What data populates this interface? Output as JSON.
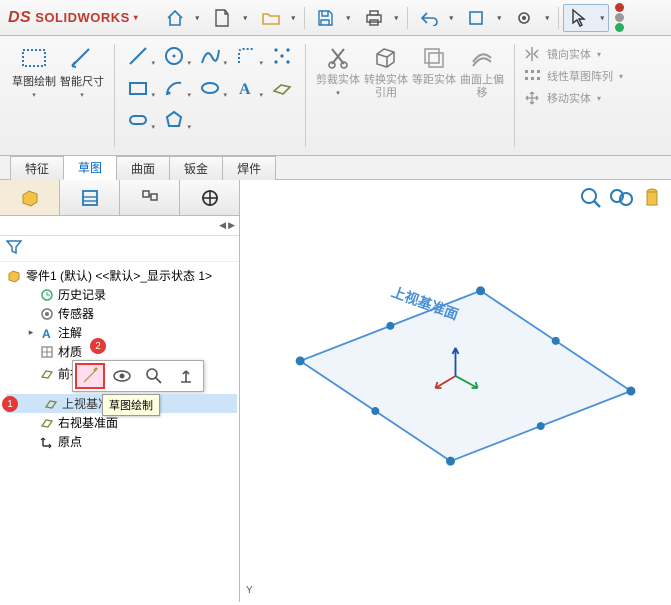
{
  "app": {
    "name": "SOLIDWORKS"
  },
  "qat": {
    "dropdown_glyph": "▾"
  },
  "ribbon": {
    "sketch_btn": "草图绘制",
    "smartdim_btn": "智能尺寸",
    "trim_btn": "剪裁实体",
    "convert_btn": "转换实体引用",
    "offset_btn": "等距实体",
    "surfoffset_btn": "曲面上偏移",
    "mirror": "镜向实体",
    "pattern": "线性草图阵列",
    "move": "移动实体"
  },
  "tabs": [
    "特征",
    "草图",
    "曲面",
    "钣金",
    "焊件"
  ],
  "active_tab": "草图",
  "tree": {
    "part": "零件1 (默认) <<默认>_显示状态 1>",
    "history": "历史记录",
    "sensors": "传感器",
    "annotations": "注解",
    "material": "材质",
    "front": "前视",
    "top": "上视基准面",
    "right": "右视基准面",
    "origin": "原点",
    "tooltip": "草图绘制"
  },
  "viewport": {
    "plane_label": "上视基准面",
    "triad": "Y"
  },
  "markers": {
    "m1": "1",
    "m2": "2"
  }
}
